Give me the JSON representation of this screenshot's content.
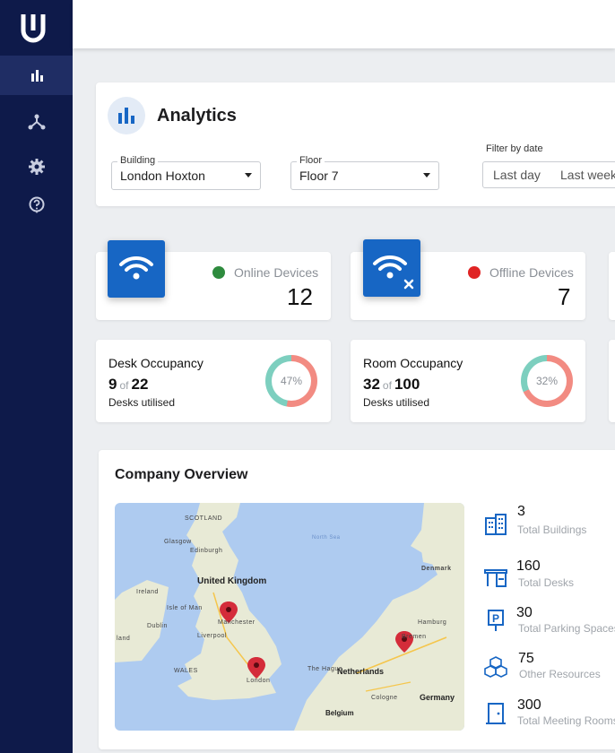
{
  "header": {
    "title": "Analytics"
  },
  "filters": {
    "building": {
      "label": "Building",
      "value": "London Hoxton"
    },
    "floor": {
      "label": "Floor",
      "value": "Floor 7"
    },
    "date": {
      "label": "Filter by date",
      "options": [
        "Last day",
        "Last week"
      ]
    }
  },
  "devices": {
    "online": {
      "label": "Online Devices",
      "count": "12",
      "status_color": "#2e8b3e"
    },
    "offline": {
      "label": "Offline Devices",
      "count": "7",
      "status_color": "#e02424"
    }
  },
  "occupancy": {
    "desk": {
      "title": "Desk Occupancy",
      "used": "9",
      "of": "of",
      "total": "22",
      "sub": "Desks utilised",
      "percent_label": "47%",
      "percent": 47
    },
    "room": {
      "title": "Room Occupancy",
      "used": "32",
      "of": "of",
      "total": "100",
      "sub": "Desks utilised",
      "percent_label": "32%",
      "percent": 32
    }
  },
  "overview": {
    "title": "Company Overview",
    "map_labels": {
      "scotland": "SCOTLAND",
      "edinburgh": "Edinburgh",
      "glasgow": "Glasgow",
      "uk": "United Kingdom",
      "north_sea": "North Sea",
      "denmark": "Denmark",
      "isle_of_man": "Isle of Man",
      "manchester": "Manchester",
      "liverpool": "Liverpool",
      "ireland": "Ireland",
      "land": "land",
      "dublin": "Dublin",
      "wales": "WALES",
      "london": "London",
      "hamburg": "Hamburg",
      "netherlands": "Netherlands",
      "germany": "Germany",
      "belgium": "Belgium",
      "cologne": "Cologne",
      "the_hague": "The Hague",
      "bremen": "Bremen"
    },
    "stats": [
      {
        "value": "3",
        "label": "Total Buildings",
        "icon": "building-icon"
      },
      {
        "value": "160",
        "label": "Total Desks",
        "icon": "desk-icon"
      },
      {
        "value": "30",
        "label": "Total Parking Spaces",
        "icon": "parking-icon"
      },
      {
        "value": "75",
        "label": "Other Resources",
        "icon": "cubes-icon"
      },
      {
        "value": "300",
        "label": "Total Meeting Rooms",
        "icon": "door-icon"
      }
    ]
  },
  "colors": {
    "sidebar": "#0e1a4a",
    "accent": "#1766c4",
    "donut_a": "#7dcfbf",
    "donut_b": "#f28b82"
  }
}
